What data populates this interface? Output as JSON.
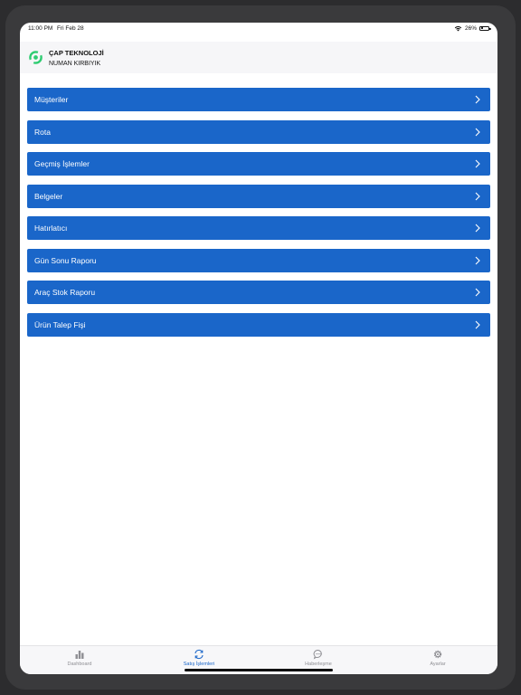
{
  "status_bar": {
    "time": "11:00 PM",
    "date": "Fri Feb 28",
    "battery": "26%",
    "battery_level": 0.26
  },
  "header": {
    "company": "ÇAP TEKNOLOJİ",
    "user": "NUMAN KIRBIYIK",
    "logo_icon": "logo-ring-icon",
    "logo_color": "#2ecc71"
  },
  "menu": {
    "items": [
      {
        "label": "Müşteriler"
      },
      {
        "label": "Rota"
      },
      {
        "label": "Geçmiş İşlemler"
      },
      {
        "label": "Belgeler"
      },
      {
        "label": "Hatırlatıcı"
      },
      {
        "label": "Gün Sonu Raporu"
      },
      {
        "label": "Araç Stok Raporu"
      },
      {
        "label": "Ürün Talep Fişi"
      }
    ],
    "item_color": "#1a66c9",
    "chevron_icon": "chevron-right-icon"
  },
  "tab_bar": {
    "tabs": [
      {
        "label": "Dashboard",
        "icon": "bar-chart-icon"
      },
      {
        "label": "Satış İşlemleri",
        "icon": "sync-icon",
        "active": true
      },
      {
        "label": "Haberleşme",
        "icon": "chat-icon"
      },
      {
        "label": "Ayarlar",
        "icon": "gear-icon"
      }
    ],
    "active_color": "#1a66c9"
  }
}
